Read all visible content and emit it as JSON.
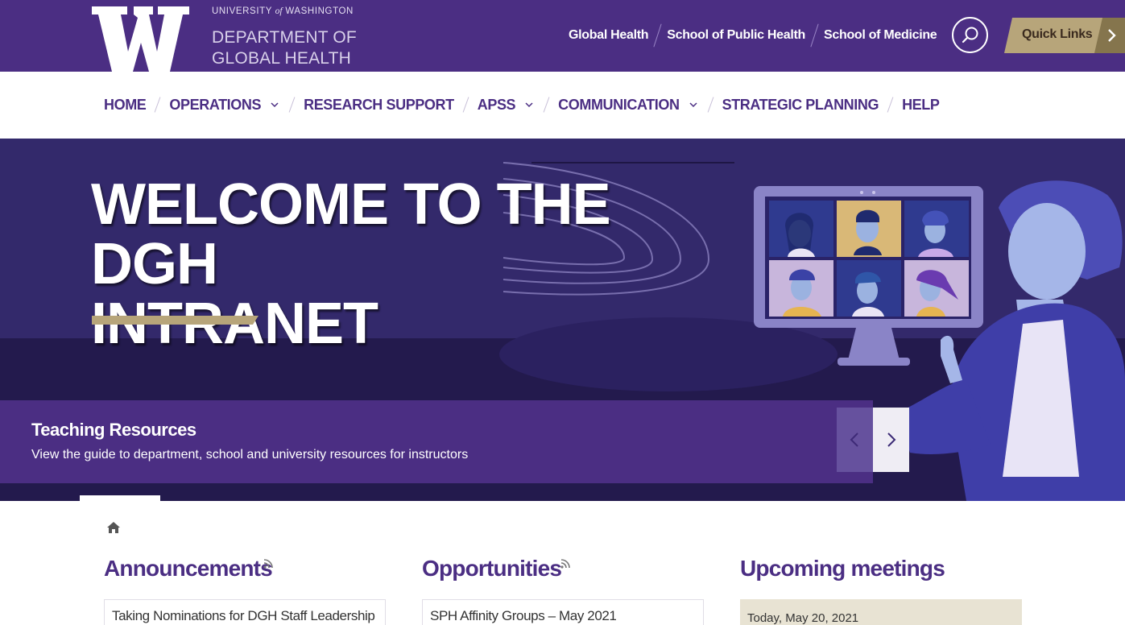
{
  "header": {
    "university": "UNIVERSITY",
    "university_of": "of",
    "university_place": "WASHINGTON",
    "dept_line1": "DEPARTMENT OF",
    "dept_line2": "GLOBAL HEALTH",
    "links": [
      "Global Health",
      "School of Public Health",
      "School of Medicine"
    ],
    "quick_links": "Quick Links",
    "icons": {
      "logo": "uw-w-logo",
      "search": "search-icon",
      "quick": "chevron-right-icon"
    },
    "colors": {
      "purple": "#4b2e83",
      "gold": "#b7a57a",
      "dark_gold": "#85754d"
    }
  },
  "nav": {
    "items": [
      {
        "label": "HOME",
        "dropdown": false
      },
      {
        "label": "OPERATIONS",
        "dropdown": true
      },
      {
        "label": "RESEARCH SUPPORT",
        "dropdown": false
      },
      {
        "label": "APSS",
        "dropdown": true
      },
      {
        "label": "COMMUNICATION",
        "dropdown": true
      },
      {
        "label": "STRATEGIC PLANNING",
        "dropdown": false
      },
      {
        "label": "HELP",
        "dropdown": false
      }
    ]
  },
  "hero": {
    "title_line1": "WELCOME TO THE DGH",
    "title_line2": "INTRANET",
    "slide_title": "Teaching Resources",
    "slide_text": "View the guide to department, school and university resources for instructors"
  },
  "main": {
    "announcements": {
      "title": "Announcements",
      "first_item": "Taking Nominations for DGH Staff Leadership"
    },
    "opportunities": {
      "title": "Opportunities",
      "first_item": "SPH Affinity Groups – May 2021"
    },
    "meetings": {
      "title": "Upcoming meetings",
      "date": "Today, May 20, 2021"
    }
  }
}
